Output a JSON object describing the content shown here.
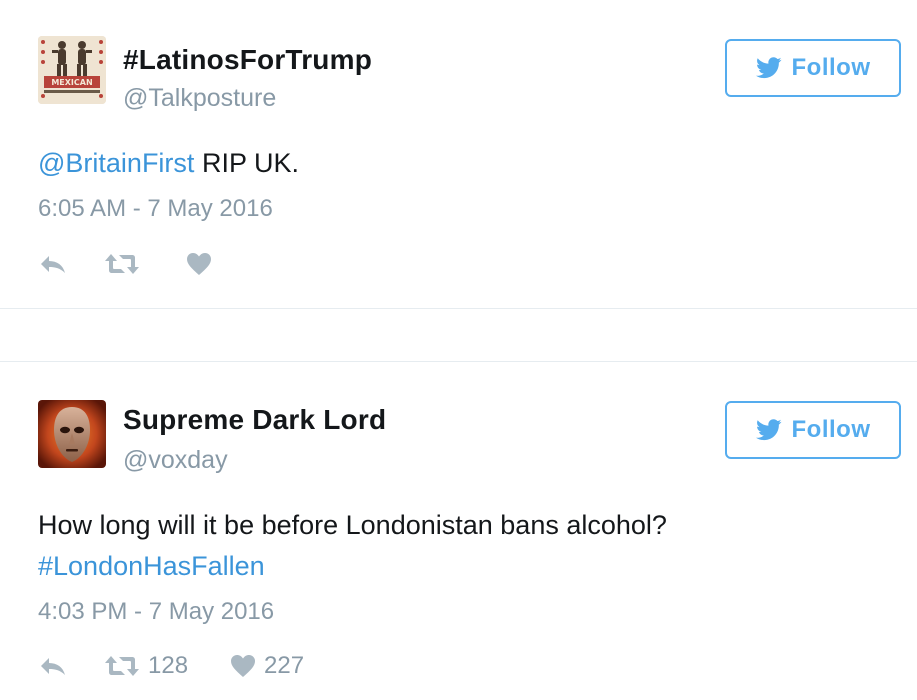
{
  "tweets": [
    {
      "display_name": "#LatinosForTrump",
      "handle": "@Talkposture",
      "follow_label": "Follow",
      "avatar_text": "MEXICAN",
      "text_mention": "@BritainFirst",
      "text_body": " RIP UK.",
      "timestamp": "6:05 AM - 7 May 2016",
      "retweet_count": "",
      "like_count": ""
    },
    {
      "display_name": "Supreme Dark Lord",
      "handle": "@voxday",
      "follow_label": "Follow",
      "text_line1": "How long will it be before Londonistan bans alcohol?",
      "text_hashtag": "#LondonHasFallen",
      "timestamp": "4:03 PM - 7 May 2016",
      "retweet_count": "128",
      "like_count": "227"
    }
  ],
  "colors": {
    "accent": "#55acee",
    "link": "#3b94d9",
    "muted": "#8899a6",
    "icon": "#aab8c2",
    "text": "#14171a"
  },
  "icons": {
    "follow": "twitter-bird-icon",
    "reply": "reply-icon",
    "retweet": "retweet-icon",
    "like": "heart-icon"
  }
}
